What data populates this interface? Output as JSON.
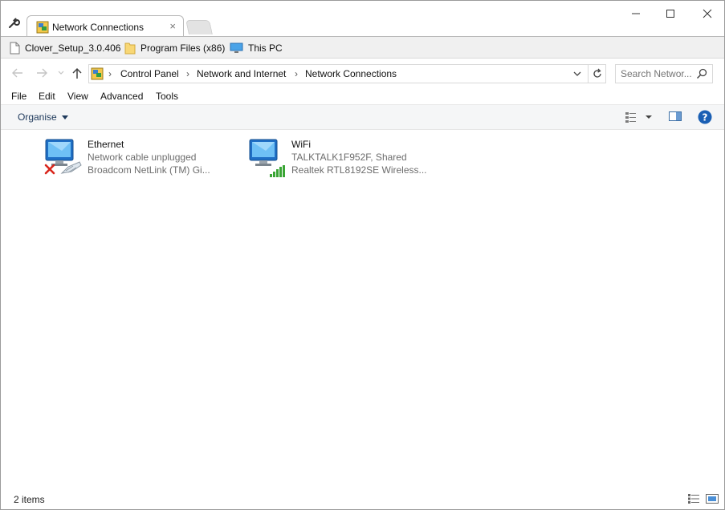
{
  "tab": {
    "title": "Network Connections",
    "close": "×"
  },
  "window_controls": {
    "minimize": "—",
    "maximize": "☐",
    "close": "✕"
  },
  "bookmarks": [
    {
      "label": "Clover_Setup_3.0.406",
      "icon": "file-icon"
    },
    {
      "label": "Program Files (x86)",
      "icon": "folder-icon"
    },
    {
      "label": "This PC",
      "icon": "computer-icon"
    }
  ],
  "address": {
    "crumbs": [
      "Control Panel",
      "Network and Internet",
      "Network Connections"
    ],
    "separator": "›"
  },
  "search": {
    "placeholder": "Search Networ..."
  },
  "menu": [
    "File",
    "Edit",
    "View",
    "Advanced",
    "Tools"
  ],
  "command_bar": {
    "organise": "Organise"
  },
  "connections": [
    {
      "name": "Ethernet",
      "status": "Network cable unplugged",
      "adapter": "Broadcom NetLink (TM) Gi...",
      "state": "disconnected"
    },
    {
      "name": "WiFi",
      "status": "TALKTALK1F952F, Shared",
      "adapter": "Realtek RTL8192SE Wireless...",
      "state": "connected"
    }
  ],
  "status_bar": {
    "item_count": "2 items"
  },
  "colors": {
    "accent": "#1e395b",
    "help": "#1a5fb4",
    "error_x": "#d9261c",
    "signal": "#3aa535"
  }
}
